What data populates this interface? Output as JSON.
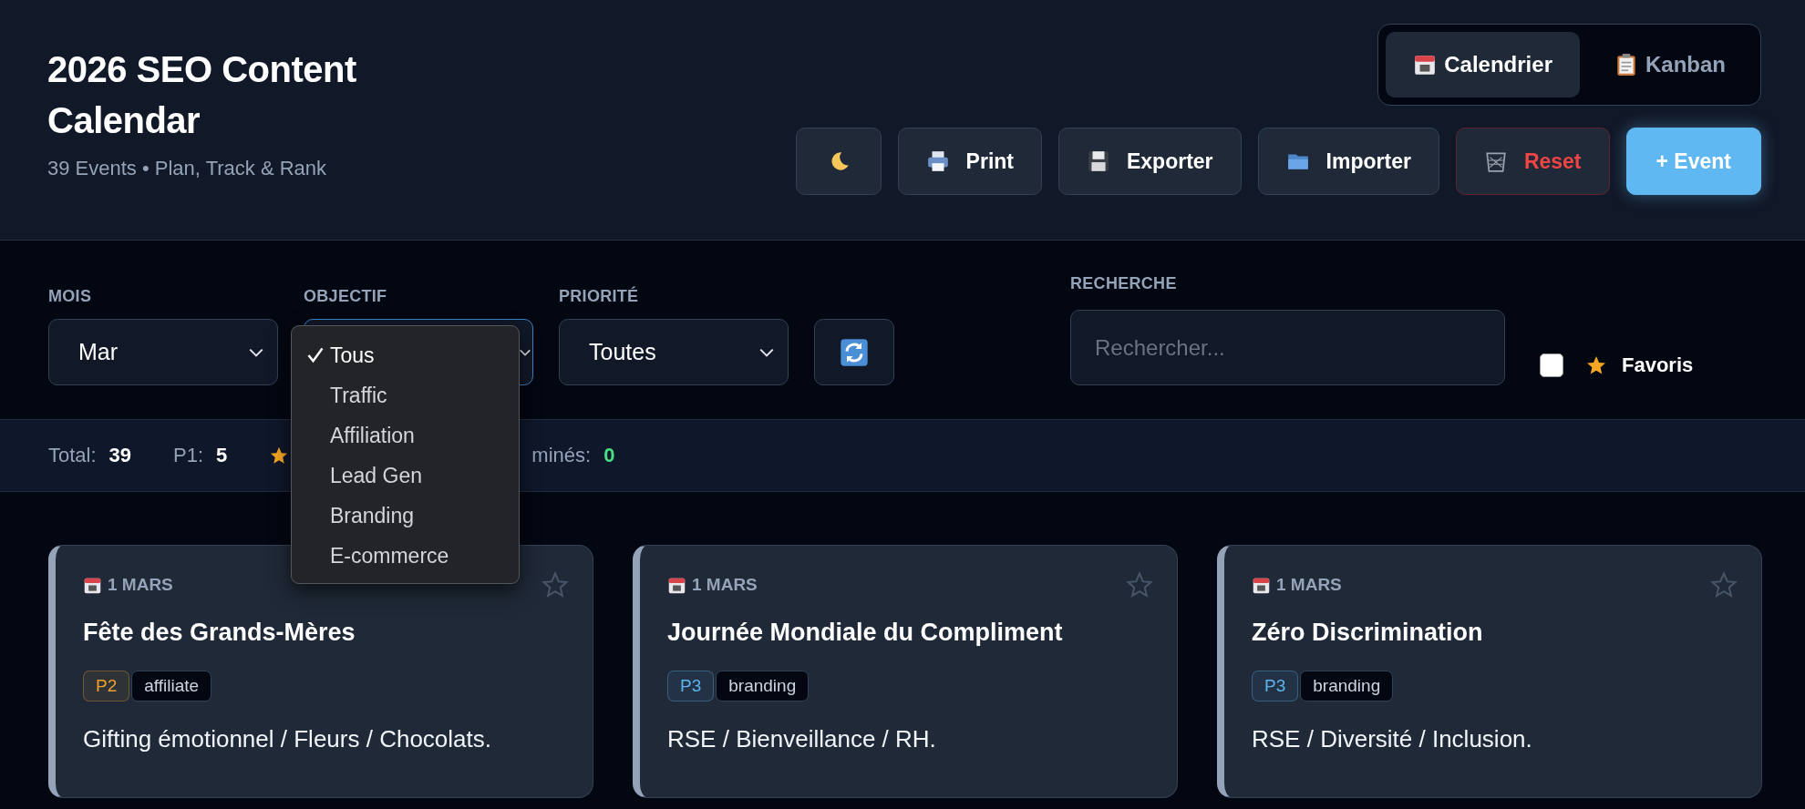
{
  "header": {
    "title": "2026 SEO Content Calendar",
    "subtitle": "39 Events • Plan, Track & Rank"
  },
  "view_tabs": [
    {
      "label": "Calendrier",
      "selected": true
    },
    {
      "label": "Kanban",
      "selected": false
    }
  ],
  "actions": [
    {
      "kind": "theme"
    },
    {
      "kind": "print",
      "label": "Print"
    },
    {
      "kind": "export",
      "label": "Exporter"
    },
    {
      "kind": "import",
      "label": "Importer"
    },
    {
      "kind": "reset",
      "label": "Reset"
    },
    {
      "kind": "add",
      "label": "+ Event"
    }
  ],
  "filters": [
    {
      "label": "MOIS",
      "value": "Mar"
    },
    {
      "label": "OBJECTIF",
      "open": true,
      "options": [
        {
          "label": "Tous",
          "selected": true
        },
        {
          "label": "Traffic",
          "selected": false
        },
        {
          "label": "Affiliation",
          "selected": false
        },
        {
          "label": "Lead Gen",
          "selected": false
        },
        {
          "label": "Branding",
          "selected": false
        },
        {
          "label": "E-commerce",
          "selected": false
        }
      ]
    },
    {
      "label": "PRIORITÉ",
      "value": "Toutes"
    }
  ],
  "search": {
    "label": "RECHERCHE",
    "placeholder": "Rechercher..."
  },
  "favorites_filter": {
    "label": "Favoris",
    "checked": false
  },
  "stats": [
    {
      "label": "Total:",
      "value": "39"
    },
    {
      "label": "P1:",
      "value": "5"
    },
    {
      "kind": "favorites"
    },
    {
      "label": "minés:",
      "value": "0",
      "color": "#4ade80"
    }
  ],
  "events": [
    {
      "date": "1 MARS",
      "title": "Fête des Grands-Mères",
      "priority": "P2",
      "color": "#f0a030",
      "tag": "affiliate",
      "description": "Gifting émotionnel / Fleurs / Chocolats.",
      "favorite": false
    },
    {
      "date": "1 MARS",
      "title": "Journée Mondiale du Compliment",
      "priority": "P3",
      "color": "#5cb3f0",
      "tag": "branding",
      "description": "RSE / Bienveillance / RH.",
      "favorite": false
    },
    {
      "date": "1 MARS",
      "title": "Zéro Discrimination",
      "priority": "P3",
      "color": "#5cb3f0",
      "tag": "branding",
      "description": "RSE / Diversité / Inclusion.",
      "favorite": false
    }
  ]
}
